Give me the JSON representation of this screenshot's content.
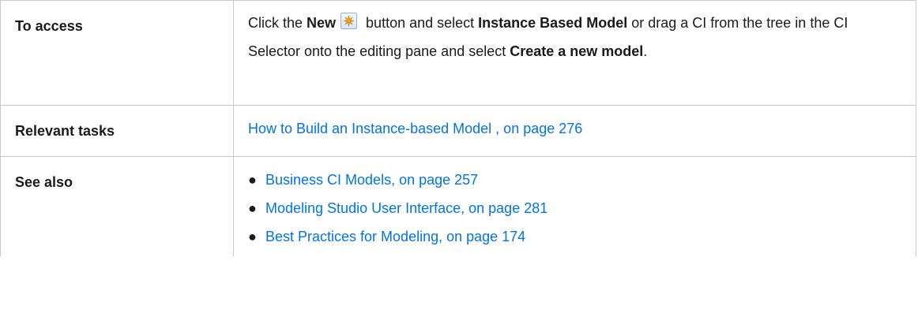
{
  "rows": {
    "access": {
      "label": "To access",
      "text_1": "Click the ",
      "new_label": "New",
      "text_2": " button and select ",
      "instance_label": "Instance Based Model",
      "text_3": " or drag a CI from the tree in the CI Selector onto the editing pane and select ",
      "create_label": "Create a new model",
      "text_4": ".",
      "new_icon": "new-star-icon"
    },
    "tasks": {
      "label": "Relevant tasks",
      "link": "How to Build an Instance-based Model , on page 276"
    },
    "see_also": {
      "label": "See also",
      "links": [
        "Business CI Models, on page 257",
        "Modeling Studio User Interface, on page 281",
        "Best Practices for Modeling, on page 174"
      ],
      "bullet": "●"
    }
  },
  "colors": {
    "link": "#0073e7",
    "border": "#c8c8c8",
    "text": "#1a1a1a"
  }
}
